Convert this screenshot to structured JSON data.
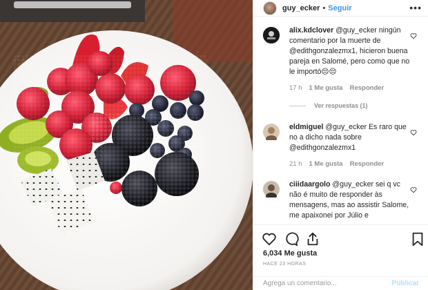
{
  "post": {
    "username": "guy_ecker",
    "follow_label": "Seguir",
    "separator": "•",
    "more_label": "•••"
  },
  "comments": [
    {
      "username": "alix.kdclover",
      "text": "@guy_ecker ningún comentario por la muerte de @edithgonzalezmx1, hicieron buena pareja en Salomé, pero como que no le importó😔😔",
      "time": "17 h",
      "likes": "1 Me gusta",
      "reply": "Responder",
      "view_replies": "Ver respuestas (1)",
      "avatar_color": "#222222"
    },
    {
      "username": "eldmiguel",
      "text": "@guy_ecker Es raro que no a dicho nada sobre @edithgonzalezmx1",
      "time": "21 h",
      "likes": "1 Me gusta",
      "reply": "Responder",
      "avatar_color": "#b08a6a"
    },
    {
      "username": "ciiidaargolo",
      "text": "@guy_ecker sei q vc não é muito de responder às mensagens, mas ao assistir Salome, me apaixonei por Júlio e",
      "avatar_color": "#7a6a5a"
    }
  ],
  "actions": {
    "like_icon": "heart-icon",
    "comment_icon": "comment-icon",
    "share_icon": "share-icon",
    "save_icon": "bookmark-icon"
  },
  "stats": {
    "likes": "6,034 Me gusta",
    "time_ago": "HACE 23 HORAS"
  },
  "add_comment": {
    "placeholder": "Agrega un comentario...",
    "publish_label": "Publicar"
  },
  "colors": {
    "link": "#3897f0",
    "muted": "#8e8e8e",
    "publish_disabled": "#b2dffc"
  }
}
